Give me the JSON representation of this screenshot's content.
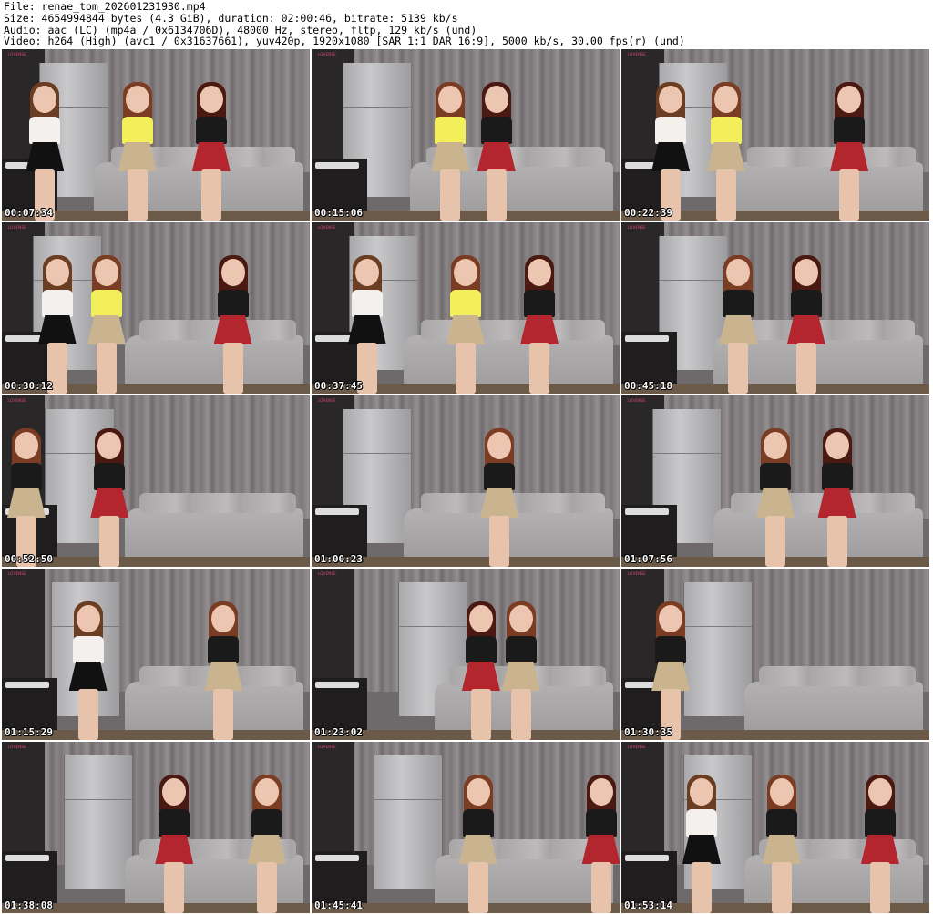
{
  "header": {
    "file_line": "File: renae_tom_202601231930.mp4",
    "size_line": "Size: 4654994844 bytes (4.3 GiB), duration: 02:00:46, bitrate: 5139 kb/s",
    "audio_line": "Audio: aac (LC) (mp4a / 0x6134706D), 48000 Hz, stereo, fltp, 129 kb/s (und)",
    "video_line": "Video: h264 (High) (avc1 / 0x31637661), yuv420p, 1920x1080 [SAR 1:1 DAR 16:9], 5000 kb/s, 30.00 fps(r) (und)"
  },
  "thumbnails": [
    {
      "timestamp": "00:07:34",
      "logo": "LOVENSE"
    },
    {
      "timestamp": "00:15:06",
      "logo": "LOVENSE"
    },
    {
      "timestamp": "00:22:39",
      "logo": "LOVENSE"
    },
    {
      "timestamp": "00:30:12",
      "logo": "LOVENSE"
    },
    {
      "timestamp": "00:37:45",
      "logo": "LOVENSE"
    },
    {
      "timestamp": "00:45:18",
      "logo": "LOVENSE"
    },
    {
      "timestamp": "00:52:50",
      "logo": "LOVENSE"
    },
    {
      "timestamp": "01:00:23",
      "logo": "LOVENSE"
    },
    {
      "timestamp": "01:07:56",
      "logo": "LOVENSE"
    },
    {
      "timestamp": "01:15:29",
      "logo": "LOVENSE"
    },
    {
      "timestamp": "01:23:02",
      "logo": "LOVENSE"
    },
    {
      "timestamp": "01:30:35",
      "logo": "LOVENSE"
    },
    {
      "timestamp": "01:38:08",
      "logo": "LOVENSE"
    },
    {
      "timestamp": "01:45:41",
      "logo": "LOVENSE"
    },
    {
      "timestamp": "01:53:14",
      "logo": "LOVENSE"
    }
  ],
  "colors": {
    "background": "#ffffff",
    "header_text": "#000000",
    "timestamp_text": "#ffffff",
    "timestamp_outline": "#000000",
    "logo_pink": "#e0457a"
  }
}
